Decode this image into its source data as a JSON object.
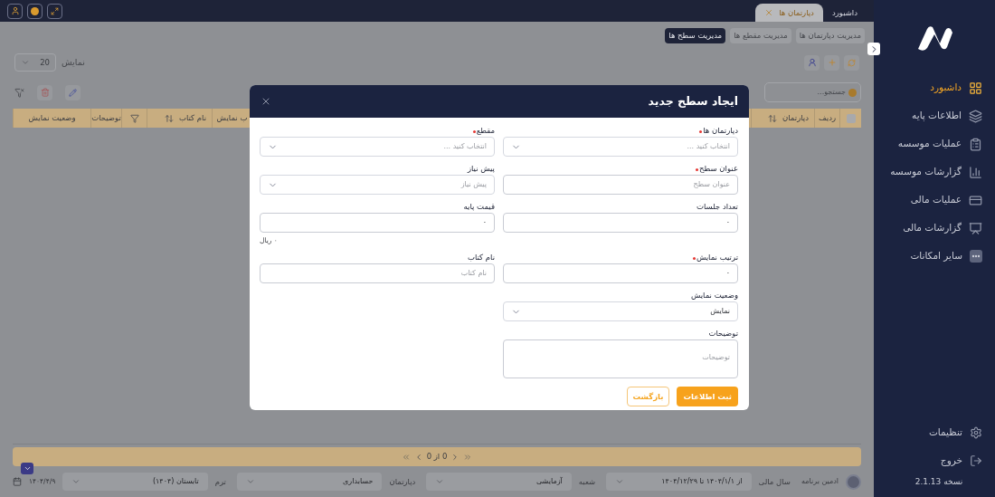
{
  "sidebar": {
    "items": [
      {
        "label": "داشبورد",
        "selected": true
      },
      {
        "label": "اطلاعات پایه",
        "selected": false
      },
      {
        "label": "عملیات موسسه",
        "selected": false
      },
      {
        "label": "گزارشات موسسه",
        "selected": false
      },
      {
        "label": "عملیات مالی",
        "selected": false
      },
      {
        "label": "گزارشات مالی",
        "selected": false
      },
      {
        "label": "سایر امکانات",
        "selected": false
      }
    ],
    "bottom_items": [
      {
        "label": "تنظیمات"
      },
      {
        "label": "خروج"
      }
    ],
    "version": "نسخه 2.1.13"
  },
  "top_tabs": [
    {
      "label": "داشبورد",
      "selected": false,
      "closable": false
    },
    {
      "label": "دپارتمان ها",
      "selected": true,
      "closable": true
    }
  ],
  "sub_tabs": [
    {
      "label": "مدیریت دپارتمان ها",
      "selected": false
    },
    {
      "label": "مدیریت مقطع ها",
      "selected": false
    },
    {
      "label": "مدیریت سطح ها",
      "selected": true
    }
  ],
  "toolbar": {
    "page_size_label": "نمایش",
    "page_size": "20",
    "search_placeholder": "جستجو..."
  },
  "table": {
    "columns_start": [
      {
        "kind": "checkbox",
        "checked": false
      },
      {
        "kind": "text",
        "label": "ردیف"
      },
      {
        "kind": "sort",
        "label": "دپارتمان"
      }
    ],
    "columns_end": [
      {
        "kind": "text",
        "label": "ب نمایش"
      },
      {
        "kind": "sort",
        "label": "نام کتاب"
      },
      {
        "kind": "filter"
      },
      {
        "kind": "text",
        "label": "توضیحات"
      },
      {
        "kind": "text",
        "label": "وضعیت نمایش"
      }
    ]
  },
  "pagination": {
    "text": "0 از 0"
  },
  "status_bar": {
    "user": "ادمین برنامه",
    "filters": [
      {
        "label": "سال مالی",
        "value": "از ۱۴۰۴/۱/۱ تا ۱۴۰۴/۱۲/۲۹"
      },
      {
        "label": "شعبه",
        "value": "آزمایشی"
      },
      {
        "label": "دپارتمان",
        "value": "حسابداری"
      },
      {
        "label": "ترم",
        "value": "تابستان (۱۴۰۴)"
      }
    ],
    "date": "۱۴۰۴/۴/۹"
  },
  "dialog": {
    "title": "ایجاد سطح جدید",
    "right_column": [
      {
        "kind": "select",
        "label": "دپارتمان ها",
        "required": true,
        "placeholder": "انتخاب کنید ..."
      },
      {
        "kind": "input",
        "label": "عنوان سطح",
        "required": true,
        "placeholder": "عنوان سطح"
      },
      {
        "kind": "input",
        "label": "تعداد جلسات",
        "required": false,
        "value": "۰"
      },
      {
        "kind": "input",
        "label": "ترتیب نمایش",
        "required": true,
        "value": "۰"
      },
      {
        "kind": "select",
        "label": "وضعیت نمایش",
        "required": false,
        "value": "نمایش"
      },
      {
        "kind": "textarea",
        "label": "توضیحات",
        "required": false,
        "placeholder": "توضیحات"
      }
    ],
    "left_column": [
      {
        "kind": "select",
        "label": "مقطع",
        "required": true,
        "placeholder": "انتخاب کنید ..."
      },
      {
        "kind": "select",
        "label": "پیش نیاز",
        "required": false,
        "placeholder": "پیش نیاز"
      },
      {
        "kind": "input",
        "label": "قیمت پایه",
        "required": false,
        "value": "۰",
        "hint": "۰ ریال"
      },
      {
        "kind": "input",
        "label": "نام کتاب",
        "required": false,
        "placeholder": "نام کتاب"
      }
    ],
    "buttons": [
      {
        "label": "ثبت اطلاعات",
        "kind": "primary"
      },
      {
        "label": "بازگشت",
        "kind": "secondary"
      }
    ]
  }
}
